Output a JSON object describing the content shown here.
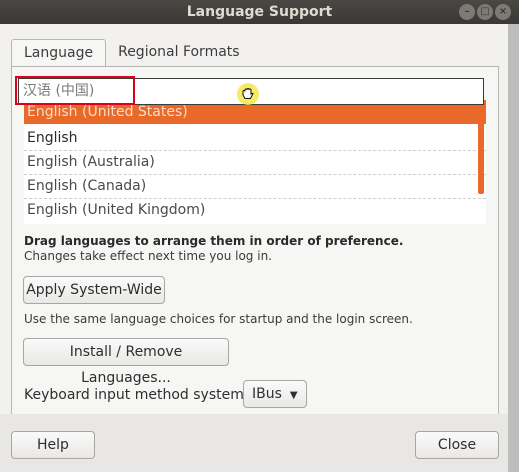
{
  "window": {
    "title": "Language Support"
  },
  "tabs": [
    {
      "label": "Language",
      "active": true
    },
    {
      "label": "Regional Formats",
      "active": false
    }
  ],
  "dragging_item": "汉语 (中国)",
  "languages": [
    {
      "label": "English (United States)",
      "selected": true
    },
    {
      "label": "English",
      "selected": false
    },
    {
      "label": "English (Australia)",
      "selected": false
    },
    {
      "label": "English (Canada)",
      "selected": false
    },
    {
      "label": "English (United Kingdom)",
      "selected": false
    }
  ],
  "hint": {
    "bold": "Drag languages to arrange them in order of preference.",
    "normal": "Changes take effect next time you log in."
  },
  "buttons": {
    "apply_system_wide": "Apply System-Wide",
    "install_remove": "Install / Remove Languages...",
    "help": "Help",
    "close": "Close"
  },
  "apply_note": "Use the same language choices for startup and the login screen.",
  "keyboard": {
    "label": "Keyboard input method system:",
    "selected": "IBus"
  },
  "colors": {
    "selection": "#e8692a",
    "highlight_box": "#e0001a",
    "titlebar": "#3a3835"
  },
  "icons": [
    "minimize-icon",
    "maximize-icon",
    "close-icon",
    "grab-hand-icon",
    "dropdown-arrow-icon"
  ]
}
